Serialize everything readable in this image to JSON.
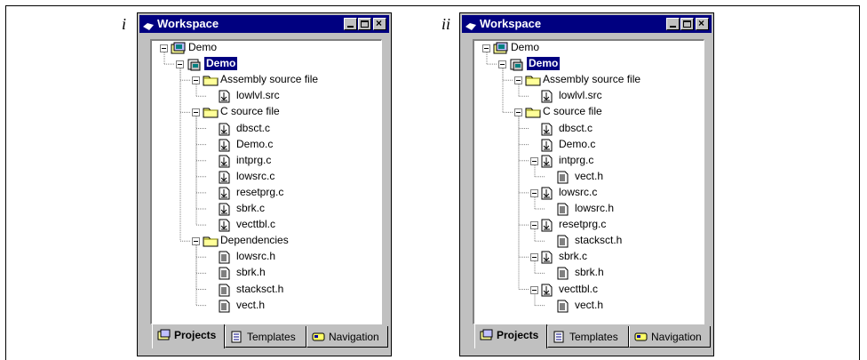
{
  "panels": [
    {
      "label": "i",
      "title": "Workspace",
      "tabs": [
        "Projects",
        "Templates",
        "Navigation"
      ],
      "tree": [
        {
          "text": "Demo",
          "icon": "workspace",
          "level": 0,
          "expander": true
        },
        {
          "text": "Demo",
          "icon": "project",
          "level": 1,
          "expander": true,
          "selected": true
        },
        {
          "text": "Assembly source file",
          "icon": "folder",
          "level": 2,
          "expander": true
        },
        {
          "text": "lowlvl.src",
          "icon": "srcfile",
          "level": 3
        },
        {
          "text": "C source file",
          "icon": "folder",
          "level": 2,
          "expander": true
        },
        {
          "text": "dbsct.c",
          "icon": "srcfile",
          "level": 3
        },
        {
          "text": "Demo.c",
          "icon": "srcfile",
          "level": 3
        },
        {
          "text": "intprg.c",
          "icon": "srcfile",
          "level": 3
        },
        {
          "text": "lowsrc.c",
          "icon": "srcfile",
          "level": 3
        },
        {
          "text": "resetprg.c",
          "icon": "srcfile",
          "level": 3
        },
        {
          "text": "sbrk.c",
          "icon": "srcfile",
          "level": 3
        },
        {
          "text": "vecttbl.c",
          "icon": "srcfile",
          "level": 3
        },
        {
          "text": "Dependencies",
          "icon": "folder",
          "level": 2,
          "expander": true
        },
        {
          "text": "lowsrc.h",
          "icon": "hfile",
          "level": 3
        },
        {
          "text": "sbrk.h",
          "icon": "hfile",
          "level": 3
        },
        {
          "text": "stacksct.h",
          "icon": "hfile",
          "level": 3
        },
        {
          "text": "vect.h",
          "icon": "hfile",
          "level": 3
        }
      ]
    },
    {
      "label": "ii",
      "title": "Workspace",
      "tabs": [
        "Projects",
        "Templates",
        "Navigation"
      ],
      "tree": [
        {
          "text": "Demo",
          "icon": "workspace",
          "level": 0,
          "expander": true
        },
        {
          "text": "Demo",
          "icon": "project",
          "level": 1,
          "expander": true,
          "selected": true
        },
        {
          "text": "Assembly source file",
          "icon": "folder",
          "level": 2,
          "expander": true
        },
        {
          "text": "lowlvl.src",
          "icon": "srcfile",
          "level": 3
        },
        {
          "text": "C source file",
          "icon": "folder",
          "level": 2,
          "expander": true
        },
        {
          "text": "dbsct.c",
          "icon": "srcfile",
          "level": 3
        },
        {
          "text": "Demo.c",
          "icon": "srcfile",
          "level": 3
        },
        {
          "text": "intprg.c",
          "icon": "srcfile",
          "level": 3,
          "expander": true
        },
        {
          "text": "vect.h",
          "icon": "hfile",
          "level": 4
        },
        {
          "text": "lowsrc.c",
          "icon": "srcfile",
          "level": 3,
          "expander": true
        },
        {
          "text": "lowsrc.h",
          "icon": "hfile",
          "level": 4
        },
        {
          "text": "resetprg.c",
          "icon": "srcfile",
          "level": 3,
          "expander": true
        },
        {
          "text": "stacksct.h",
          "icon": "hfile",
          "level": 4
        },
        {
          "text": "sbrk.c",
          "icon": "srcfile",
          "level": 3,
          "expander": true
        },
        {
          "text": "sbrk.h",
          "icon": "hfile",
          "level": 4
        },
        {
          "text": "vecttbl.c",
          "icon": "srcfile",
          "level": 3,
          "expander": true
        },
        {
          "text": "vect.h",
          "icon": "hfile",
          "level": 4
        }
      ]
    }
  ]
}
